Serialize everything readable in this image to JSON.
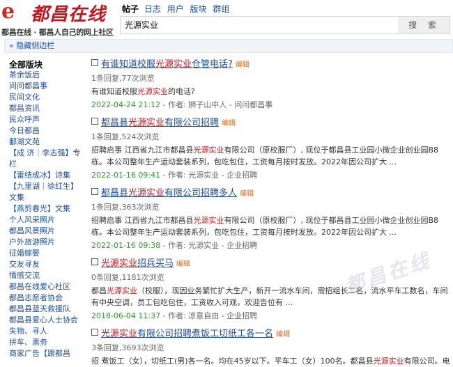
{
  "header": {
    "logo_mark": "e",
    "brand": "都昌在线",
    "slogan": "都昌在线 · 都昌人自己的网上社区",
    "nav_current": "帖子",
    "nav_links": [
      "日志",
      "用户",
      "版块",
      "群组"
    ],
    "search_value": "光源实业",
    "search_button": "搜 索"
  },
  "toggle": {
    "label": "« 隐藏侧边栏"
  },
  "sidebar": {
    "heading": "全部版块",
    "items": [
      "茶余饭后",
      "问问都昌事",
      "民间文化",
      "都昌资讯",
      "民众呼声",
      "今日都昌",
      "鄱湖文苑",
      "【成 济｜李志强】专栏",
      "【雷结成冰】诗集",
      "【九里湖｜徐红生】文集",
      "【燕剪春光】文集",
      "个人风采照片",
      "都昌风景照片",
      "户外旅游照片",
      "征婚嫁娶",
      "交友寻友",
      "情感交流",
      "都昌在线爱心社区",
      "都昌志愿者协会",
      "都昌县蓝天救援队",
      "都昌县爱心人士协会",
      "失物、寻人",
      "拼车、票务",
      "商家广告【跟都昌"
    ]
  },
  "results": [
    {
      "title_pre": "有谁知道校服",
      "title_hl": "光源实业",
      "title_post": "仓管电话?",
      "edit": "编辑",
      "meta": "1条回复,77次浏览",
      "snippet_pre": "有谁知道校服",
      "snippet_hl": "光源实业",
      "snippet_post": "的电话?",
      "date": "2022-04-24 21:12",
      "author_label": "作者",
      "author": "狮子山中人",
      "board": "问问都昌事"
    },
    {
      "title_pre": "都昌县",
      "title_hl": "光源实业",
      "title_post": "有限公司招聘",
      "edit": "编辑",
      "meta": "1条回复,524次浏览",
      "snippet_pre": "招聘启事 江西省九江市都昌县",
      "snippet_hl": "光源实业",
      "snippet_post": "有限公司（原校服厂）, 现位于都昌县工业园小微企业创业园B8栋。本公司整年生产运动套装系列，包吃包住，工资每月按时发放。2022年因公司扩大 ...",
      "date": "2022-01-16 09:41",
      "author_label": "作者",
      "author": "光源实业",
      "board": "企业招聘"
    },
    {
      "title_pre": "都昌县",
      "title_hl": "光源实业",
      "title_post": "有限公司招聘多人",
      "edit": "编辑",
      "meta": "1条回复,363次浏览",
      "snippet_pre": "招聘启事 江西省九江市都昌县",
      "snippet_hl": "光源实业",
      "snippet_post": "有限公司（原校服厂）, 现位于都昌县工业园小微企业创业园B8栋。本公司整年生产运动套装系列，包吃包住，工资每月按时发放。2022年因公司扩大 ...",
      "date": "2022-01-16 09:38",
      "author_label": "作者",
      "author": "光源实业",
      "board": "企业招聘"
    },
    {
      "title_pre": "",
      "title_hl": "光源实业",
      "title_post": "招兵买马",
      "edit": "编辑",
      "meta": "0条回复,1181次浏览",
      "snippet_pre": "都昌",
      "snippet_hl": "光源实业",
      "snippet_post": "（校服），现因业务繁忙扩大生产，新开一流水车间，需招组长二名，流水平车工数名，车间有中央空调，员工包吃包住，工资收入可观，欢迎告位有 ...",
      "date": "2018-06-04 11:37",
      "author_label": "作者",
      "author": "凉意自由",
      "board": "企业招聘"
    },
    {
      "title_pre": "",
      "title_hl": "光源实业",
      "title_post": "有限公司招聘煮饭工切纸工各一名",
      "edit": "编辑",
      "meta": "3条回复,3693次浏览",
      "snippet_pre": "招 煮饭工（女），切纸工(男)各一名。均在45岁以下。平车工（女）100名。都昌县",
      "snippet_hl": "光源实业",
      "snippet_post": "有限公司。电",
      "date": "",
      "author_label": "",
      "author": "",
      "board": ""
    }
  ],
  "watermark": "都昌在线",
  "colors": {
    "accent_link": "#1a4ea6",
    "highlight": "#d2141b",
    "date": "#2a9d2a",
    "edit": "#e26a1c",
    "brand": "#c8141b"
  }
}
